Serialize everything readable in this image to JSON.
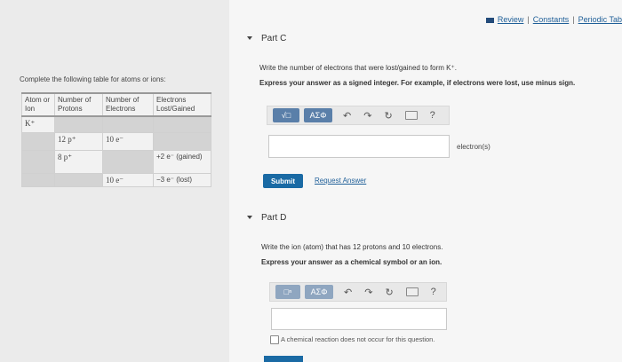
{
  "topbar": {
    "review": "Review",
    "sep1": "|",
    "constants": "Constants",
    "sep2": "|",
    "periodic": "Periodic Tab"
  },
  "left": {
    "instruction": "Complete the following table for atoms or ions:",
    "headers": [
      "Atom or Ion",
      "Number of Protons",
      "Number of Electrons",
      "Electrons Lost/Gained"
    ],
    "rows": [
      [
        "K⁺",
        "",
        "",
        ""
      ],
      [
        "",
        "12 p⁺",
        "10 e⁻",
        ""
      ],
      [
        "",
        "8 p⁺",
        "",
        "+2 e⁻ (gained)"
      ],
      [
        "",
        "",
        "10 e⁻",
        "−3 e⁻ (lost)"
      ]
    ]
  },
  "partC": {
    "title": "Part C",
    "question": "Write the number of electrons that were lost/gained to form K⁺.",
    "instruction": "Express your answer as a signed integer. For example, if electrons were lost, use minus sign.",
    "toolbar": {
      "templates": "√□",
      "symbols": "ΑΣΦ",
      "undo": "↶",
      "redo": "↷",
      "reset": "↻",
      "help": "?"
    },
    "answer": "",
    "unit": "electron(s)",
    "submit": "Submit",
    "request": "Request Answer"
  },
  "partD": {
    "title": "Part D",
    "question": "Write the ion (atom) that has 12 protons and 10 electrons.",
    "instruction": "Express your answer as a chemical symbol or an ion.",
    "toolbar": {
      "templates": "□ⁿ",
      "symbols": "ΑΣΦ",
      "undo": "↶",
      "redo": "↷",
      "reset": "↻",
      "help": "?"
    },
    "answer": "",
    "no_reaction": "A chemical reaction does not occur for this question."
  },
  "colors": {
    "accent": "#1a6aa4",
    "toolbar_button": "#5a7fa9",
    "link": "#1f5f98"
  }
}
